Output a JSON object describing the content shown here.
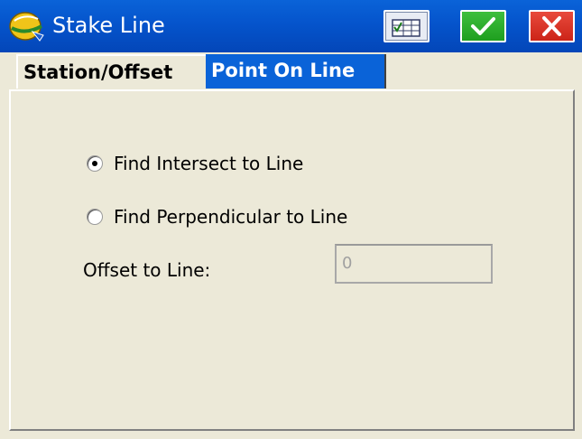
{
  "window": {
    "title": "Stake Line",
    "title_icon": "helmet-icon",
    "buttons": {
      "grid": "grid-icon",
      "ok": "check-icon",
      "close": "close-icon"
    },
    "accent_color": "#0a63d8"
  },
  "tabs": [
    {
      "label": "Station/Offset",
      "selected": false
    },
    {
      "label": "Point On Line",
      "selected": true
    }
  ],
  "options": {
    "find_intersect": {
      "label": "Find Intersect to Line",
      "checked": true
    },
    "find_perpendicular": {
      "label": "Find Perpendicular to Line",
      "checked": false
    }
  },
  "offset": {
    "label": "Offset to Line:",
    "value": "0",
    "enabled": false
  }
}
